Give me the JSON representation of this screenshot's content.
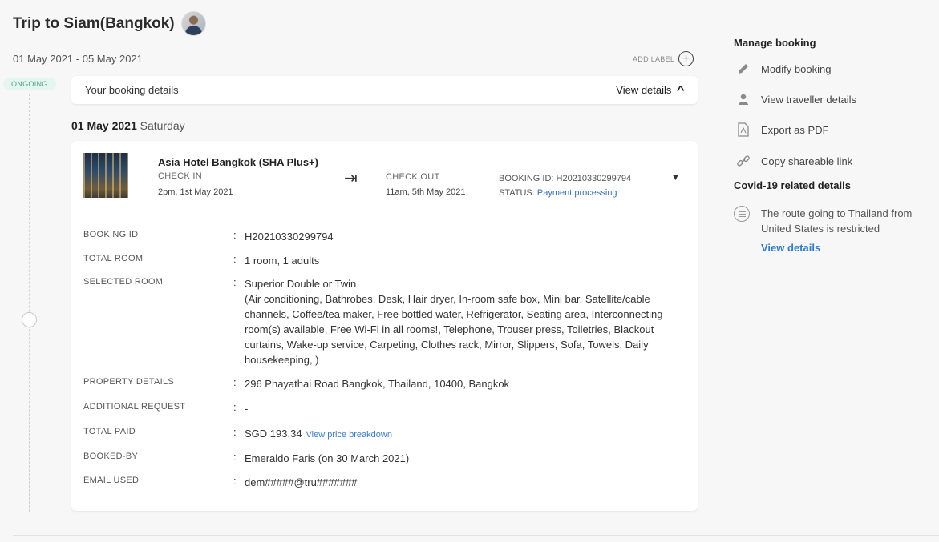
{
  "trip": {
    "title": "Trip to Siam(Bangkok)",
    "date_range": "01 May 2021 - 05 May 2021",
    "add_label": "ADD LABEL",
    "status_badge": "ONGOING"
  },
  "booking_bar": {
    "label": "Your booking details",
    "view_details": "View details"
  },
  "day": {
    "date": "01 May 2021",
    "weekday": "Saturday"
  },
  "hotel": {
    "name": "Asia Hotel Bangkok (SHA Plus+)",
    "check_in_label": "CHECK IN",
    "check_in_time": "2pm, 1st May 2021",
    "check_out_label": "CHECK OUT",
    "check_out_time": "11am, 5th May 2021",
    "booking_id_line": "BOOKING ID: H20210330299794",
    "status_prefix": "STATUS:",
    "status_value": "Payment processing"
  },
  "details": {
    "rows": [
      {
        "key": "BOOKING ID",
        "value": "H20210330299794"
      },
      {
        "key": "TOTAL ROOM",
        "value": "1 room, 1 adults"
      },
      {
        "key": "SELECTED ROOM",
        "value": "Superior Double or Twin",
        "value2": "(Air conditioning, Bathrobes, Desk, Hair dryer, In-room safe box, Mini bar, Satellite/cable channels, Coffee/tea maker, Free bottled water, Refrigerator, Seating area, Interconnecting room(s) available, Free Wi-Fi in all rooms!, Telephone, Trouser press, Toiletries, Blackout curtains, Wake-up service, Carpeting, Clothes rack, Mirror, Slippers, Sofa, Towels, Daily housekeeping, )"
      },
      {
        "key": "PROPERTY DETAILS",
        "value": "296 Phayathai Road Bangkok, Thailand, 10400, Bangkok"
      },
      {
        "key": "ADDITIONAL REQUEST",
        "value": "-"
      },
      {
        "key": "TOTAL PAID",
        "value": "SGD 193.34",
        "link": "View price breakdown"
      },
      {
        "key": "BOOKED-BY",
        "value": "Emeraldo Faris (on 30 March 2021)"
      },
      {
        "key": "EMAIL USED",
        "value": "dem#####@tru#######"
      }
    ],
    "colon": ":"
  },
  "sidebar": {
    "manage_heading": "Manage booking",
    "items": [
      {
        "label": "Modify booking",
        "icon": "pencil-icon"
      },
      {
        "label": "View traveller details",
        "icon": "person-icon"
      },
      {
        "label": "Export as PDF",
        "icon": "pdf-icon"
      },
      {
        "label": "Copy shareable link",
        "icon": "link-icon"
      }
    ],
    "covid_heading": "Covid-19 related details",
    "covid_text": "The route going to Thailand from United States is restricted",
    "covid_link": "View details"
  }
}
